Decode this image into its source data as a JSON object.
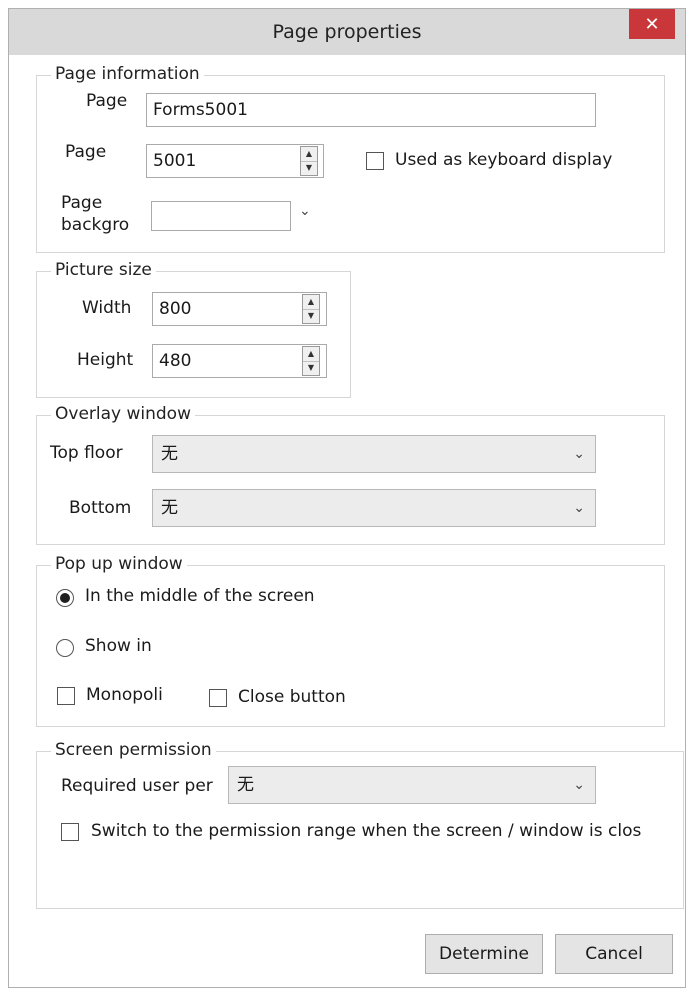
{
  "window": {
    "title": "Page properties",
    "close_glyph": "✕"
  },
  "page_information": {
    "title": "Page information",
    "page_name_label": "Page",
    "page_name_value": "Forms5001",
    "page_number_label": "Page",
    "page_number_value": "5001",
    "keyboard_display_label": "Used as keyboard display",
    "keyboard_display_checked": false,
    "background_label_line1": "Page",
    "background_label_line2": "backgro",
    "background_value": ""
  },
  "picture_size": {
    "title": "Picture size",
    "width_label": "Width",
    "width_value": "800",
    "height_label": "Height",
    "height_value": "480"
  },
  "overlay_window": {
    "title": "Overlay window",
    "top_floor_label": "Top floor",
    "top_floor_value": "无",
    "bottom_label": "Bottom",
    "bottom_value": "无"
  },
  "popup_window": {
    "title": "Pop up window",
    "options": [
      {
        "label": "In the middle of the screen",
        "selected": true
      },
      {
        "label": "Show in",
        "selected": false
      }
    ],
    "monopoly_label": "Monopoli",
    "close_button_label": "Close button"
  },
  "screen_permission": {
    "title": "Screen permission",
    "required_user_label": "Required user per",
    "required_user_value": "无",
    "switch_label": "Switch to the permission range when the screen / window is clos"
  },
  "buttons": {
    "determine": "Determine",
    "cancel": "Cancel"
  },
  "icons": {
    "dropdown_arrow": "⌄",
    "spin_up": "▲",
    "spin_down": "▼"
  },
  "colors": {
    "close_button": "#c9373a",
    "titlebar": "#d9d9d9"
  }
}
